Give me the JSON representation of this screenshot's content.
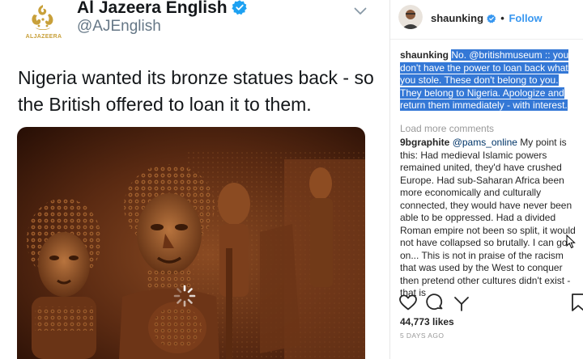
{
  "tweet": {
    "account_name": "Al Jazeera English",
    "handle": "@AJEnglish",
    "logo_text": "ALJAZEERA",
    "text": "Nigeria wanted its bronze statues back - so the British offered to loan it to them."
  },
  "instagram": {
    "username": "shaunking",
    "follow_label": "Follow",
    "separator": "•",
    "comments": [
      {
        "user": "shaunking",
        "text": "No. @britishmuseum :: you don't have the power to loan back what you stole. These don't belong to you. They belong to Nigeria. Apologize and return them immediately - with interest."
      },
      {
        "user": "9bgraphite",
        "mention": "@pams_online",
        "text": "My point is this: Had medieval Islamic powers remained united, they'd have crushed Europe. Had sub-Saharan Africa been more economically and culturally connected, they would have never been able to be oppressed. Had a divided Roman empire not been so split, it would not have collapsed so brutally. I can go on... This is not in praise of the racism that was used by the West to conquer then pretend other cultures didn't exist - that is"
      }
    ],
    "load_more": "Load more comments",
    "likes": "44,773 likes",
    "time_ago": "5 DAYS AGO"
  },
  "colors": {
    "accent_blue": "#3897f0",
    "selection": "#3478d6",
    "twitter_text": "#14171a",
    "twitter_muted": "#657786",
    "aj_gold": "#c8a03a"
  },
  "icons": [
    "aj-logo-icon",
    "verified-badge-icon",
    "chevron-down-icon",
    "loading-spinner-icon",
    "heart-icon",
    "comment-icon",
    "share-icon",
    "bookmark-icon",
    "cursor-icon"
  ]
}
